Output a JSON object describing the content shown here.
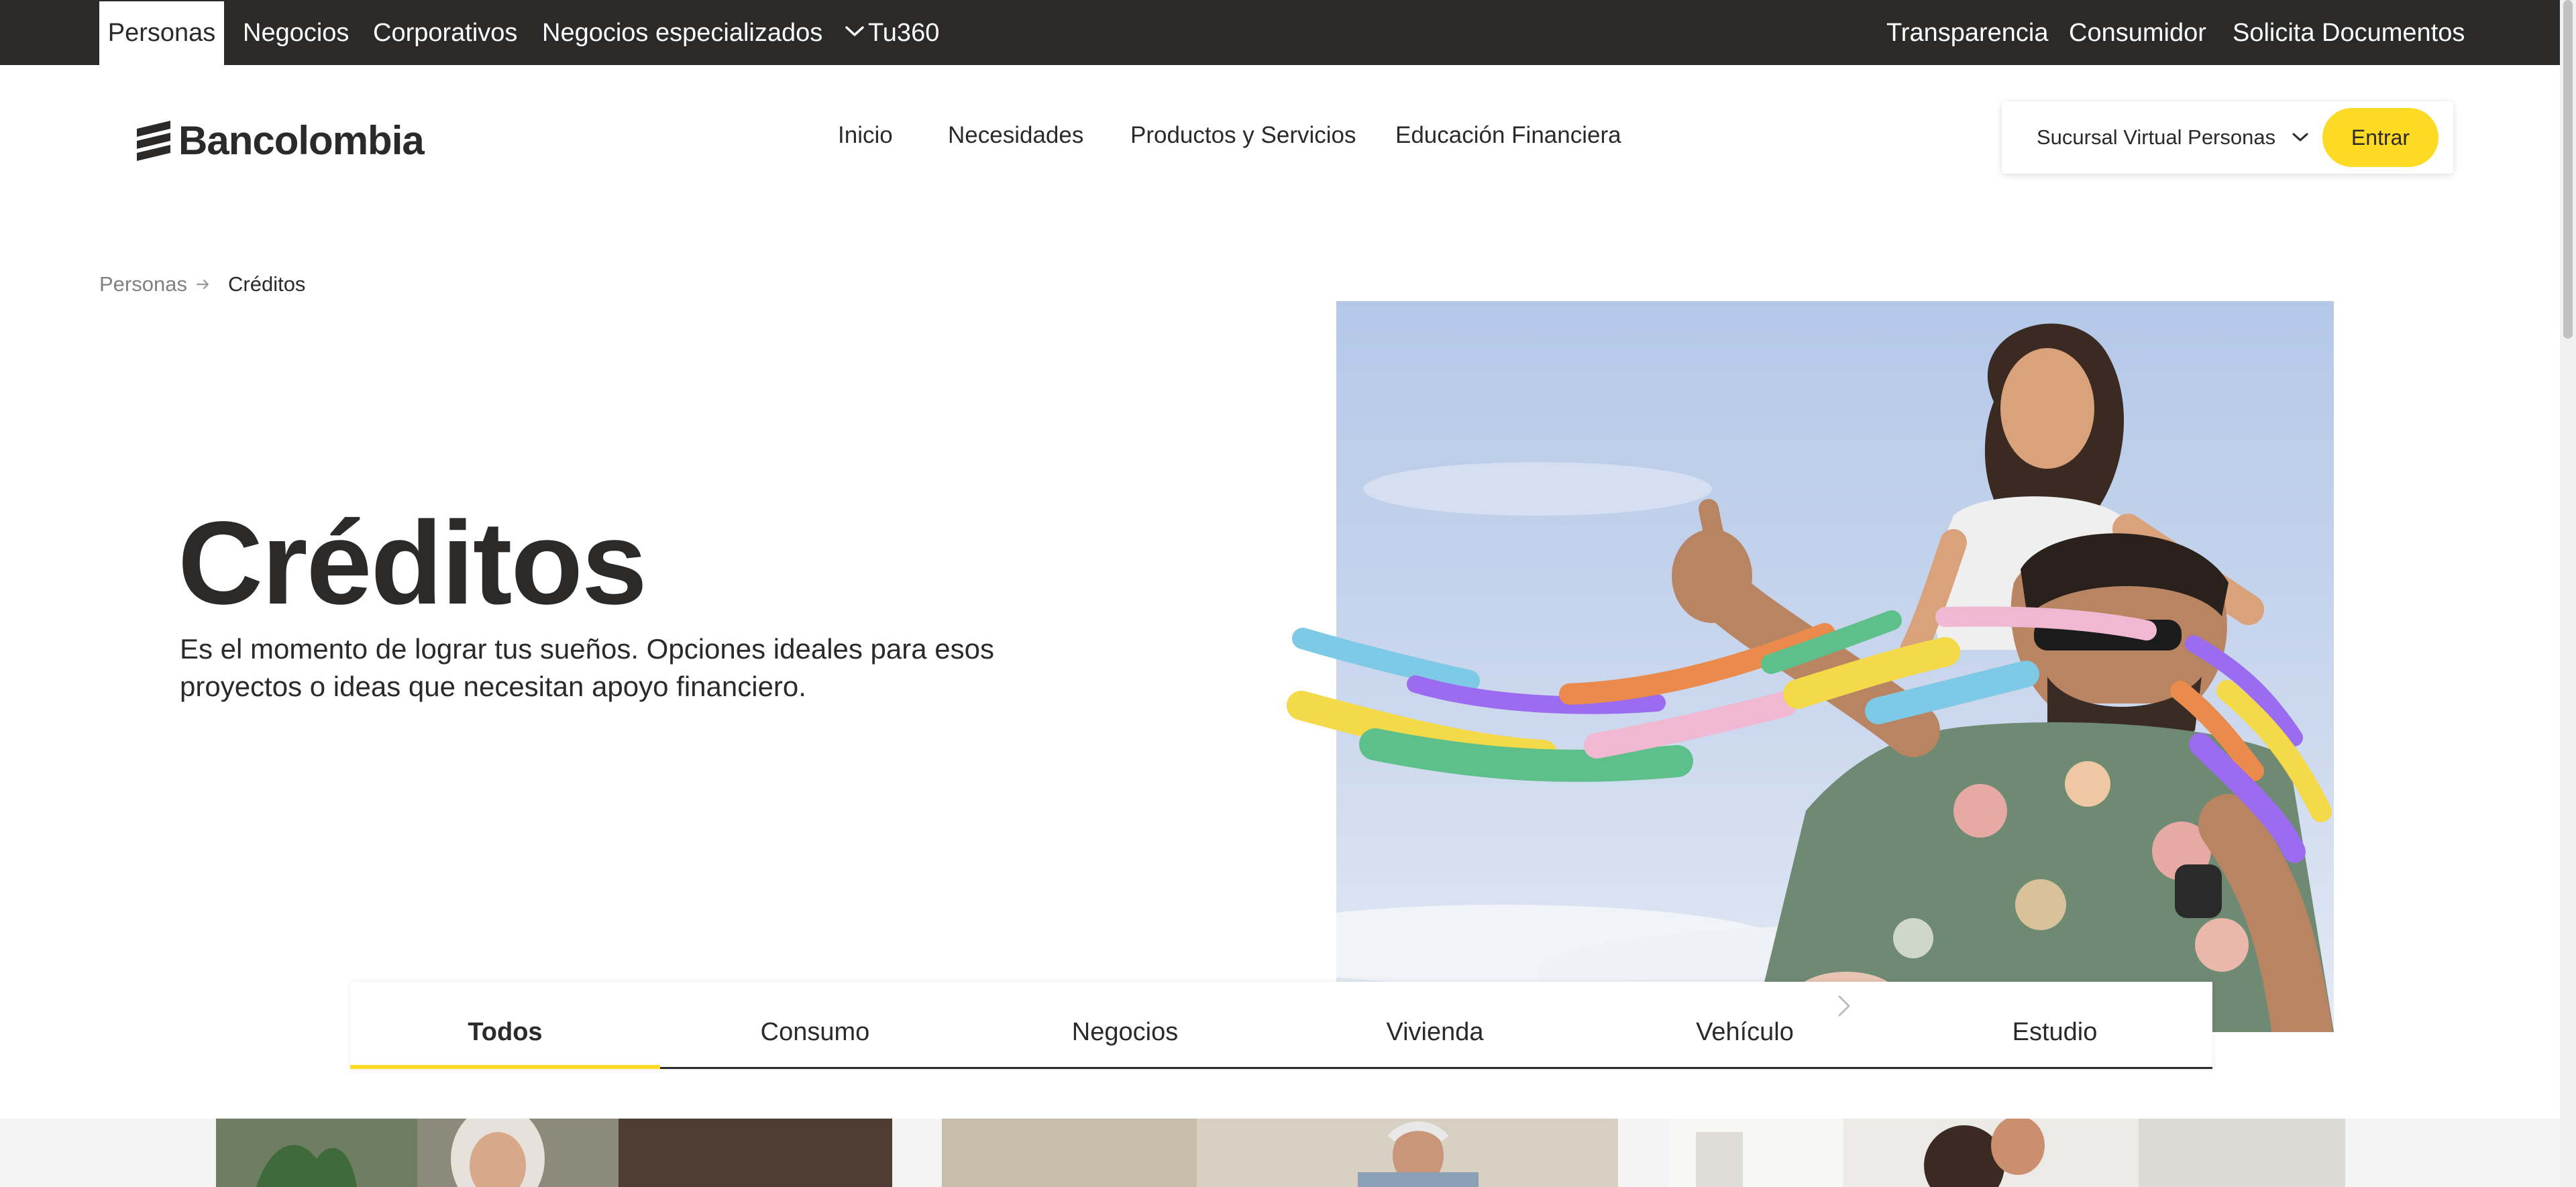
{
  "topbar": {
    "items": [
      {
        "label": "Personas",
        "active": true
      },
      {
        "label": "Negocios"
      },
      {
        "label": "Corporativos"
      },
      {
        "label": "Negocios especializados",
        "icon": "chevron-down-icon"
      },
      {
        "label": "Tu360"
      }
    ],
    "right_items": [
      {
        "label": "Transparencia"
      },
      {
        "label": "Consumidor"
      },
      {
        "label": "Solicita Documentos"
      }
    ]
  },
  "header": {
    "logo_text": "Bancolombia",
    "nav": [
      "Inicio",
      "Necesidades",
      "Productos y Servicios",
      "Educación Financiera"
    ],
    "sucursal_label": "Sucursal Virtual Personas",
    "entrar_label": "Entrar"
  },
  "breadcrumb": {
    "items": [
      "Personas",
      "Créditos"
    ],
    "separator_icon": "arrow-right-icon"
  },
  "hero": {
    "title": "Créditos",
    "description": "Es el momento de lograr tus sueños. Opciones ideales para esos proyectos o ideas que necesitan apoyo financiero."
  },
  "tabs": {
    "items": [
      "Todos",
      "Consumo",
      "Negocios",
      "Vivienda",
      "Vehículo",
      "Estudio"
    ],
    "active_index": 0,
    "next_icon": "chevron-right-icon"
  },
  "colors": {
    "topbar_bg": "#2c2a29",
    "accent_yellow": "#fdda24",
    "text_dark": "#2c2a29",
    "ribbon_blue": "#7ec9e6",
    "ribbon_purple": "#9b6bf0",
    "ribbon_orange": "#ea8a4c",
    "ribbon_green": "#5dbf8a",
    "ribbon_pink": "#f0b8d2",
    "ribbon_yellow": "#f4d948"
  }
}
